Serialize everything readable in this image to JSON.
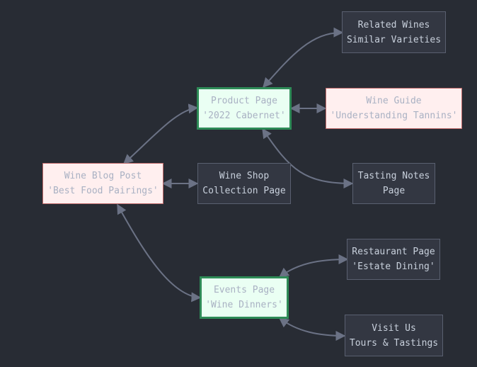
{
  "colors": {
    "background": "#282c34",
    "edge": "#6b7285",
    "default_fill": "#333742",
    "default_stroke": "#5a6070",
    "pink_fill": "#ffefef",
    "pink_stroke": "#c06a6a",
    "green_fill": "#eafff3",
    "green_stroke": "#2e8b57"
  },
  "nodes": {
    "related_wines": {
      "line1": "Related Wines",
      "line2": "Similar Varieties",
      "style": "default"
    },
    "product_page": {
      "line1": "Product Page",
      "line2": "'2022 Cabernet'",
      "style": "green"
    },
    "wine_guide": {
      "line1": "Wine Guide",
      "line2": "'Understanding Tannins'",
      "style": "pink"
    },
    "wine_blog": {
      "line1": "Wine Blog Post",
      "line2": "'Best Food Pairings'",
      "style": "pink"
    },
    "wine_shop": {
      "line1": "Wine Shop",
      "line2": "Collection Page",
      "style": "default"
    },
    "tasting_notes": {
      "line1": "Tasting Notes",
      "line2": "Page",
      "style": "default"
    },
    "restaurant": {
      "line1": "Restaurant Page",
      "line2": "'Estate Dining'",
      "style": "default"
    },
    "events_page": {
      "line1": "Events Page",
      "line2": "'Wine Dinners'",
      "style": "green"
    },
    "visit_us": {
      "line1": "Visit Us",
      "line2": "Tours & Tastings",
      "style": "default"
    }
  },
  "edges": [
    {
      "from": "product_page",
      "to": "related_wines",
      "bidirectional": true
    },
    {
      "from": "product_page",
      "to": "wine_guide",
      "bidirectional": true
    },
    {
      "from": "product_page",
      "to": "tasting_notes",
      "bidirectional": true
    },
    {
      "from": "wine_blog",
      "to": "product_page",
      "bidirectional": true
    },
    {
      "from": "wine_blog",
      "to": "wine_shop",
      "bidirectional": true
    },
    {
      "from": "wine_blog",
      "to": "events_page",
      "bidirectional": true
    },
    {
      "from": "events_page",
      "to": "restaurant",
      "bidirectional": true
    },
    {
      "from": "events_page",
      "to": "visit_us",
      "bidirectional": true
    }
  ]
}
